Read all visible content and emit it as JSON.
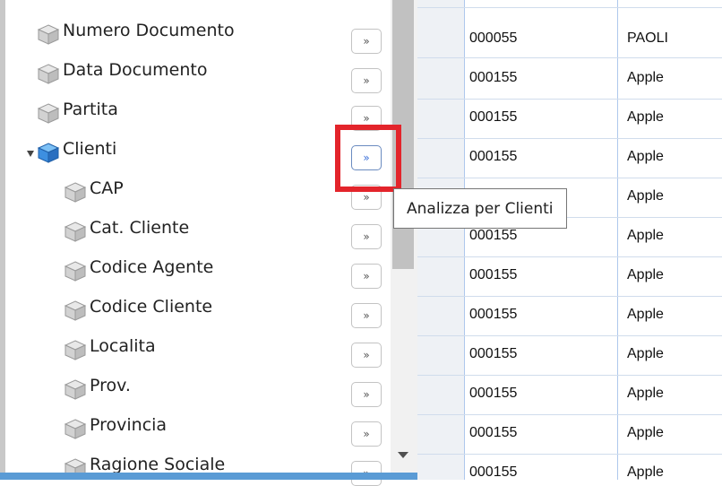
{
  "tree": {
    "items": [
      {
        "label": "Numero Documento",
        "icon": "cube-gray-icon",
        "expandable": false
      },
      {
        "label": "Data Documento",
        "icon": "cube-gray-icon",
        "expandable": false
      },
      {
        "label": "Partita",
        "icon": "cube-gray-icon",
        "expandable": false
      },
      {
        "label": "Clienti",
        "icon": "cube-blue-icon",
        "expandable": true,
        "expanded": true
      },
      {
        "label": "CAP",
        "icon": "cube-gray-icon",
        "expandable": false
      },
      {
        "label": "Cat. Cliente",
        "icon": "cube-gray-icon",
        "expandable": false
      },
      {
        "label": "Codice Agente",
        "icon": "cube-gray-icon",
        "expandable": false
      },
      {
        "label": "Codice Cliente",
        "icon": "cube-gray-icon",
        "expandable": false
      },
      {
        "label": "Localita",
        "icon": "cube-gray-icon",
        "expandable": false
      },
      {
        "label": "Prov.",
        "icon": "cube-gray-icon",
        "expandable": false
      },
      {
        "label": "Provincia",
        "icon": "cube-gray-icon",
        "expandable": false
      },
      {
        "label": "Ragione Sociale",
        "icon": "cube-gray-icon",
        "expandable": false
      }
    ]
  },
  "analyze_button_label": "»",
  "tooltip": {
    "text": "Analizza per Clienti"
  },
  "grid": {
    "rows": [
      {
        "code": "000055",
        "name": "PAOLI"
      },
      {
        "code": "000155",
        "name": "Apple"
      },
      {
        "code": "000155",
        "name": "Apple"
      },
      {
        "code": "000155",
        "name": "Apple"
      },
      {
        "code": "",
        "name": "Apple"
      },
      {
        "code": "000155",
        "name": "Apple"
      },
      {
        "code": "000155",
        "name": "Apple"
      },
      {
        "code": "000155",
        "name": "Apple"
      },
      {
        "code": "000155",
        "name": "Apple"
      },
      {
        "code": "000155",
        "name": "Apple"
      },
      {
        "code": "000155",
        "name": "Apple"
      },
      {
        "code": "000155",
        "name": "Apple"
      }
    ]
  },
  "colors": {
    "highlight": "#e3242b",
    "accent": "#5a9bd5",
    "cube_gray": "#c8c8c8",
    "cube_blue": "#3d8fe0"
  }
}
